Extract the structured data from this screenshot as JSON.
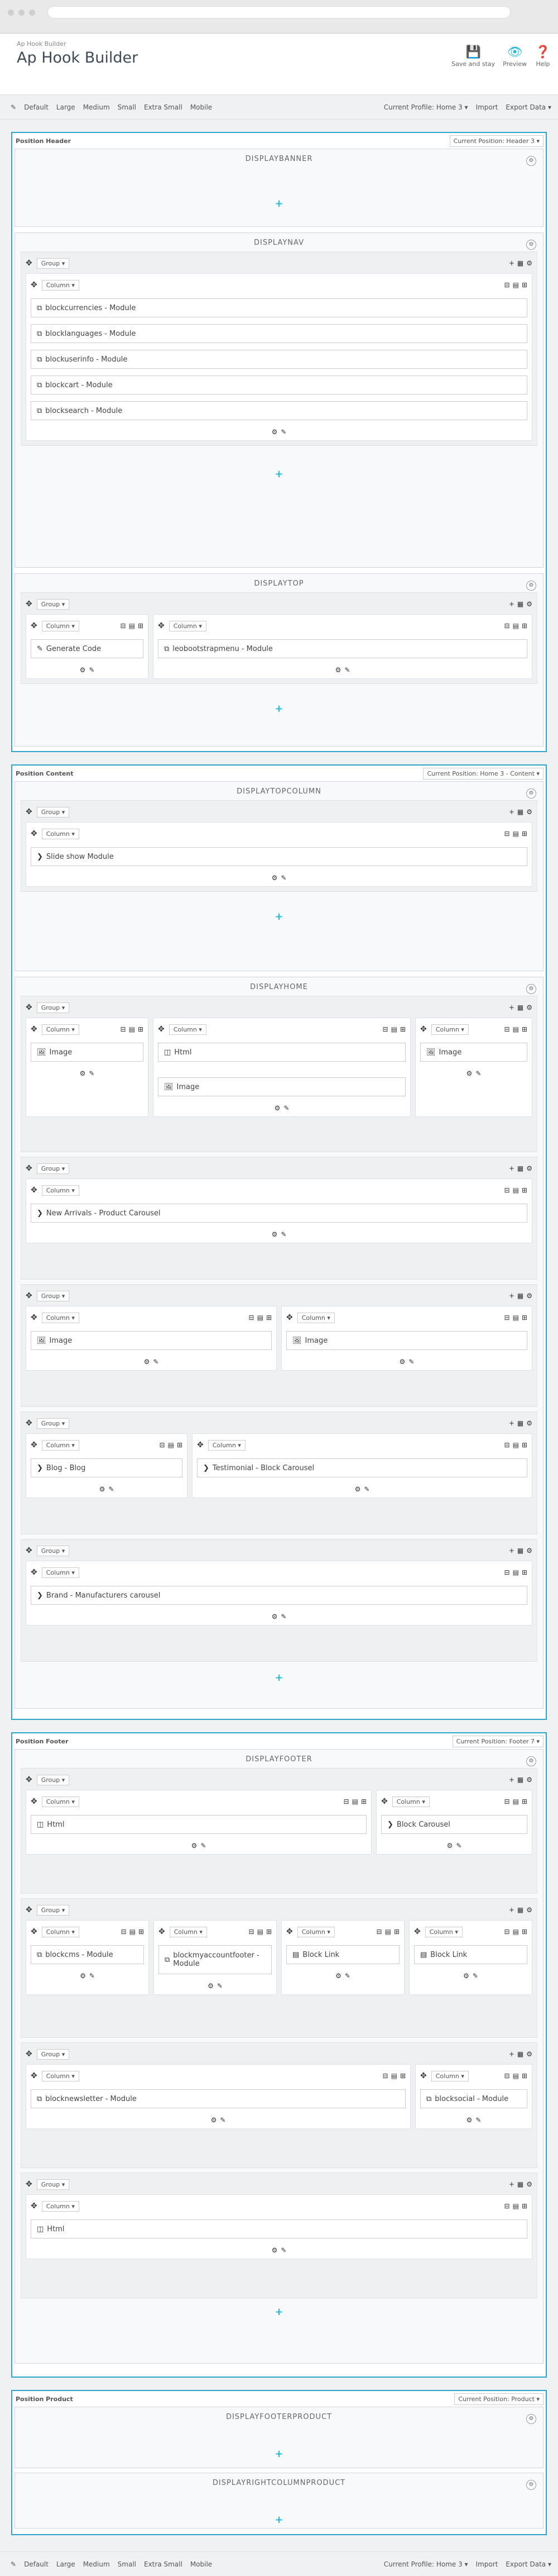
{
  "header": {
    "breadcrumb": "Ap Hook Builder",
    "title": "Ap Hook Builder",
    "save": "Save and stay",
    "preview": "Preview",
    "help": "Help"
  },
  "toolbar": {
    "sizes": [
      "Default",
      "Large",
      "Medium",
      "Small",
      "Extra Small",
      "Mobile"
    ],
    "profile": "Current Profile: Home 3 ▾",
    "import": "Import",
    "export": "Export Data ▾"
  },
  "labels": {
    "group": "Group ▾",
    "column": "Column ▾"
  },
  "positions": {
    "header": {
      "label": "Position Header",
      "btn": "Current Position: Header 3 ▾"
    },
    "content": {
      "label": "Position Content",
      "btn": "Current Position: Home 3 - Content ▾"
    },
    "footer": {
      "label": "Position Footer",
      "btn": "Current Position: Footer 7 ▾"
    },
    "product": {
      "label": "Position Product",
      "btn": "Current Position: Product ▾"
    }
  },
  "hooks": {
    "banner": "DISPLAYBANNER",
    "nav": "DISPLAYNAV",
    "top": "DISPLAYTOP",
    "topcolumn": "DISPLAYTOPCOLUMN",
    "home": "DISPLAYHOME",
    "footer": "DISPLAYFOOTER",
    "footerproduct": "DISPLAYFOOTERPRODUCT",
    "rightcolumnproduct": "DISPLAYRIGHTCOLUMNPRODUCT"
  },
  "widgets": {
    "nav": [
      "blockcurrencies - Module",
      "blocklanguages - Module",
      "blockuserinfo - Module",
      "blockcart - Module",
      "blocksearch - Module"
    ],
    "gen": "Generate Code",
    "megamenu": "leobootstrapmenu - Module",
    "slideshow": "Slide show Module",
    "image": "Image",
    "html": "Html",
    "arrivals": "New Arrivals - Product Carousel",
    "blog": "Blog - Blog",
    "testimonial": "Testimonial - Block Carousel",
    "brand": "Brand - Manufacturers carousel",
    "blockcarousel": "Block Carousel",
    "blockcms": "blockcms - Module",
    "myaccount": "blockmyaccountfooter - Module",
    "blocklink": "Block Link",
    "newsletter": "blocknewsletter - Module",
    "social": "blocksocial - Module"
  }
}
